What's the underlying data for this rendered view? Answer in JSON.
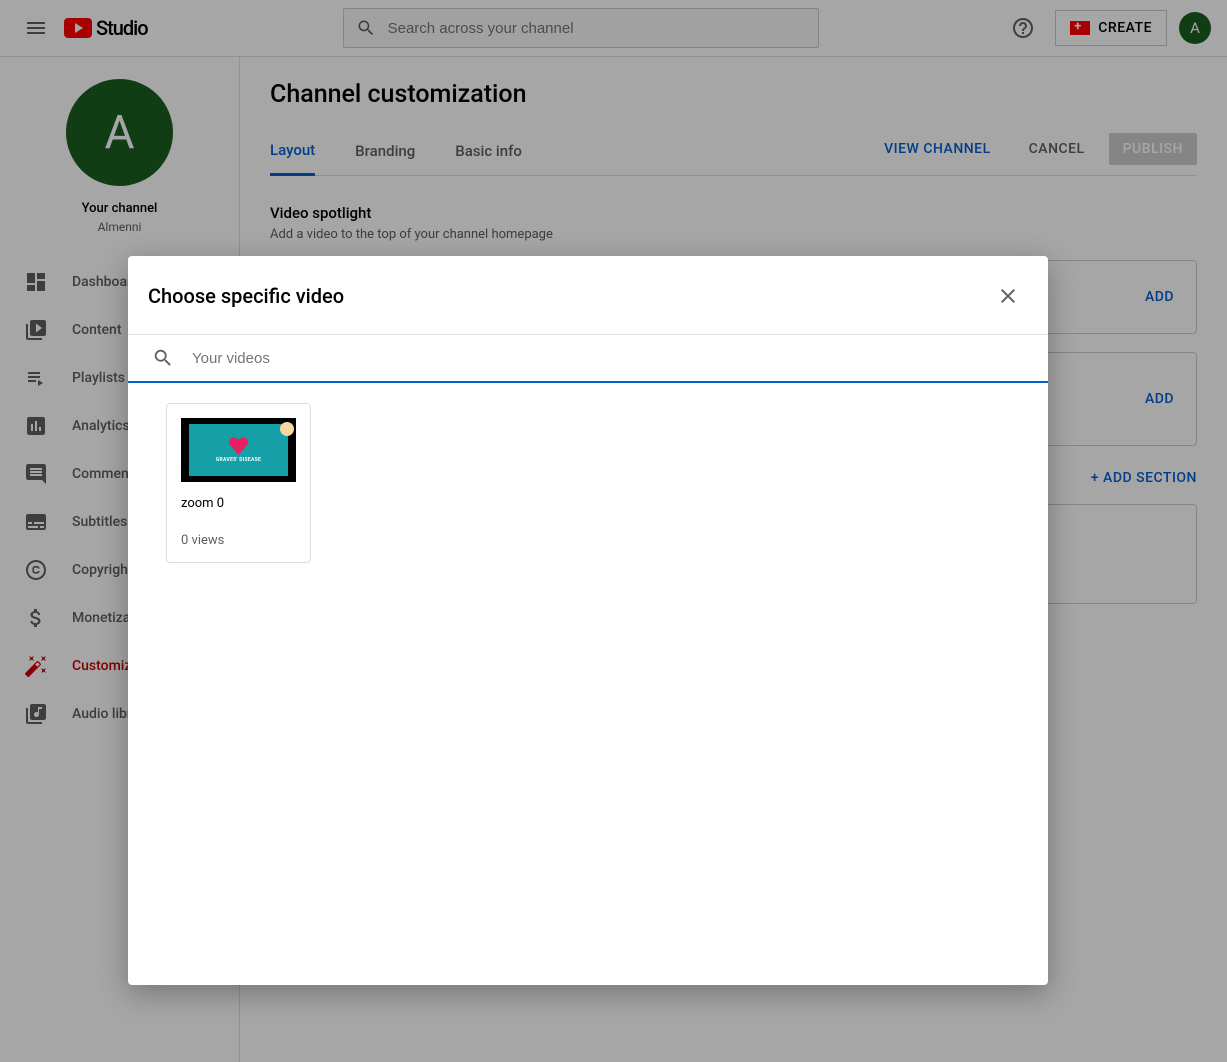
{
  "header": {
    "logo_text": "Studio",
    "search_placeholder": "Search across your channel",
    "create_label": "CREATE",
    "avatar_letter": "A"
  },
  "sidebar": {
    "channel_avatar_letter": "A",
    "channel_label": "Your channel",
    "channel_name": "Almenni",
    "items": [
      {
        "label": "Dashboard"
      },
      {
        "label": "Content"
      },
      {
        "label": "Playlists"
      },
      {
        "label": "Analytics"
      },
      {
        "label": "Comments"
      },
      {
        "label": "Subtitles"
      },
      {
        "label": "Copyright"
      },
      {
        "label": "Monetization"
      },
      {
        "label": "Customization"
      },
      {
        "label": "Audio library"
      }
    ]
  },
  "main": {
    "title": "Channel customization",
    "tabs": [
      {
        "label": "Layout"
      },
      {
        "label": "Branding"
      },
      {
        "label": "Basic info"
      }
    ],
    "view_channel": "VIEW CHANNEL",
    "cancel": "CANCEL",
    "publish": "PUBLISH",
    "spotlight_title": "Video spotlight",
    "spotlight_sub": "Add a video to the top of your channel homepage",
    "add_label": "ADD",
    "add_section": "+ ADD SECTION"
  },
  "dialog": {
    "title": "Choose specific video",
    "search_placeholder": "Your videos",
    "videos": [
      {
        "title": "zoom 0",
        "views": "0 views",
        "thumb_text": "GRAVES' DISEASE"
      }
    ]
  }
}
